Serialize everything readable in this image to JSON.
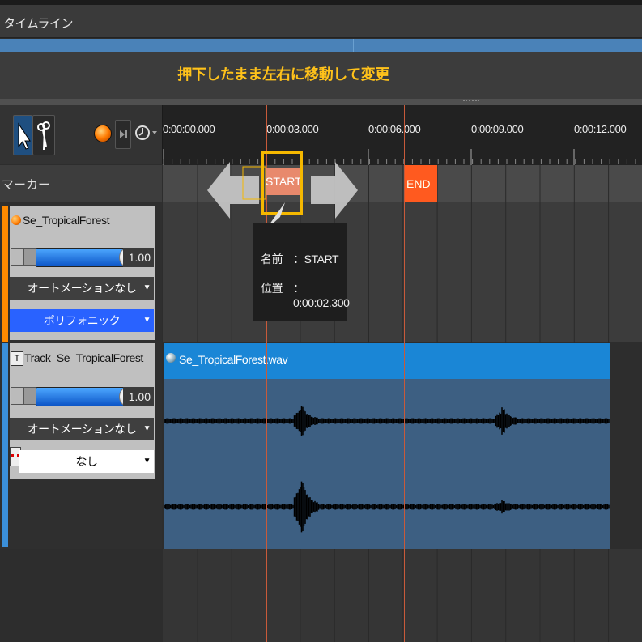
{
  "panel": {
    "title": "タイムライン"
  },
  "hint": {
    "text": "押下したまま左右に移動して変更"
  },
  "ruler": {
    "ticks": [
      "0:00:00.000",
      "0:00:03.000",
      "0:00:06.000",
      "0:00:09.000",
      "0:00:12.000"
    ]
  },
  "markers": {
    "header": "マーカー",
    "start_label": "START",
    "end_label": "END"
  },
  "tooltip": {
    "name_label": "名前",
    "name_value": "：START",
    "pos_label": "位置",
    "pos_value": "：0:00:02.300"
  },
  "tracks": [
    {
      "name": "Se_TropicalForest",
      "volume": "1.00",
      "automation": "オートメーションなし",
      "mode": "ポリフォニック"
    },
    {
      "name": "Track_Se_TropicalForest",
      "volume": "1.00",
      "automation": "オートメーションなし",
      "mode": "なし"
    }
  ],
  "clip": {
    "name": "Se_TropicalForest.wav"
  },
  "colors": {
    "accent": "#1a86d6",
    "hint": "#ffc21a",
    "end_marker": "#ff5a1f",
    "highlight": "#f5b800"
  },
  "icons": [
    "select-arrow-icon",
    "scissors-icon",
    "record-icon",
    "step-icon",
    "clock-icon",
    "marker-left-arrow-icon",
    "marker-right-arrow-icon",
    "audio-icon"
  ]
}
